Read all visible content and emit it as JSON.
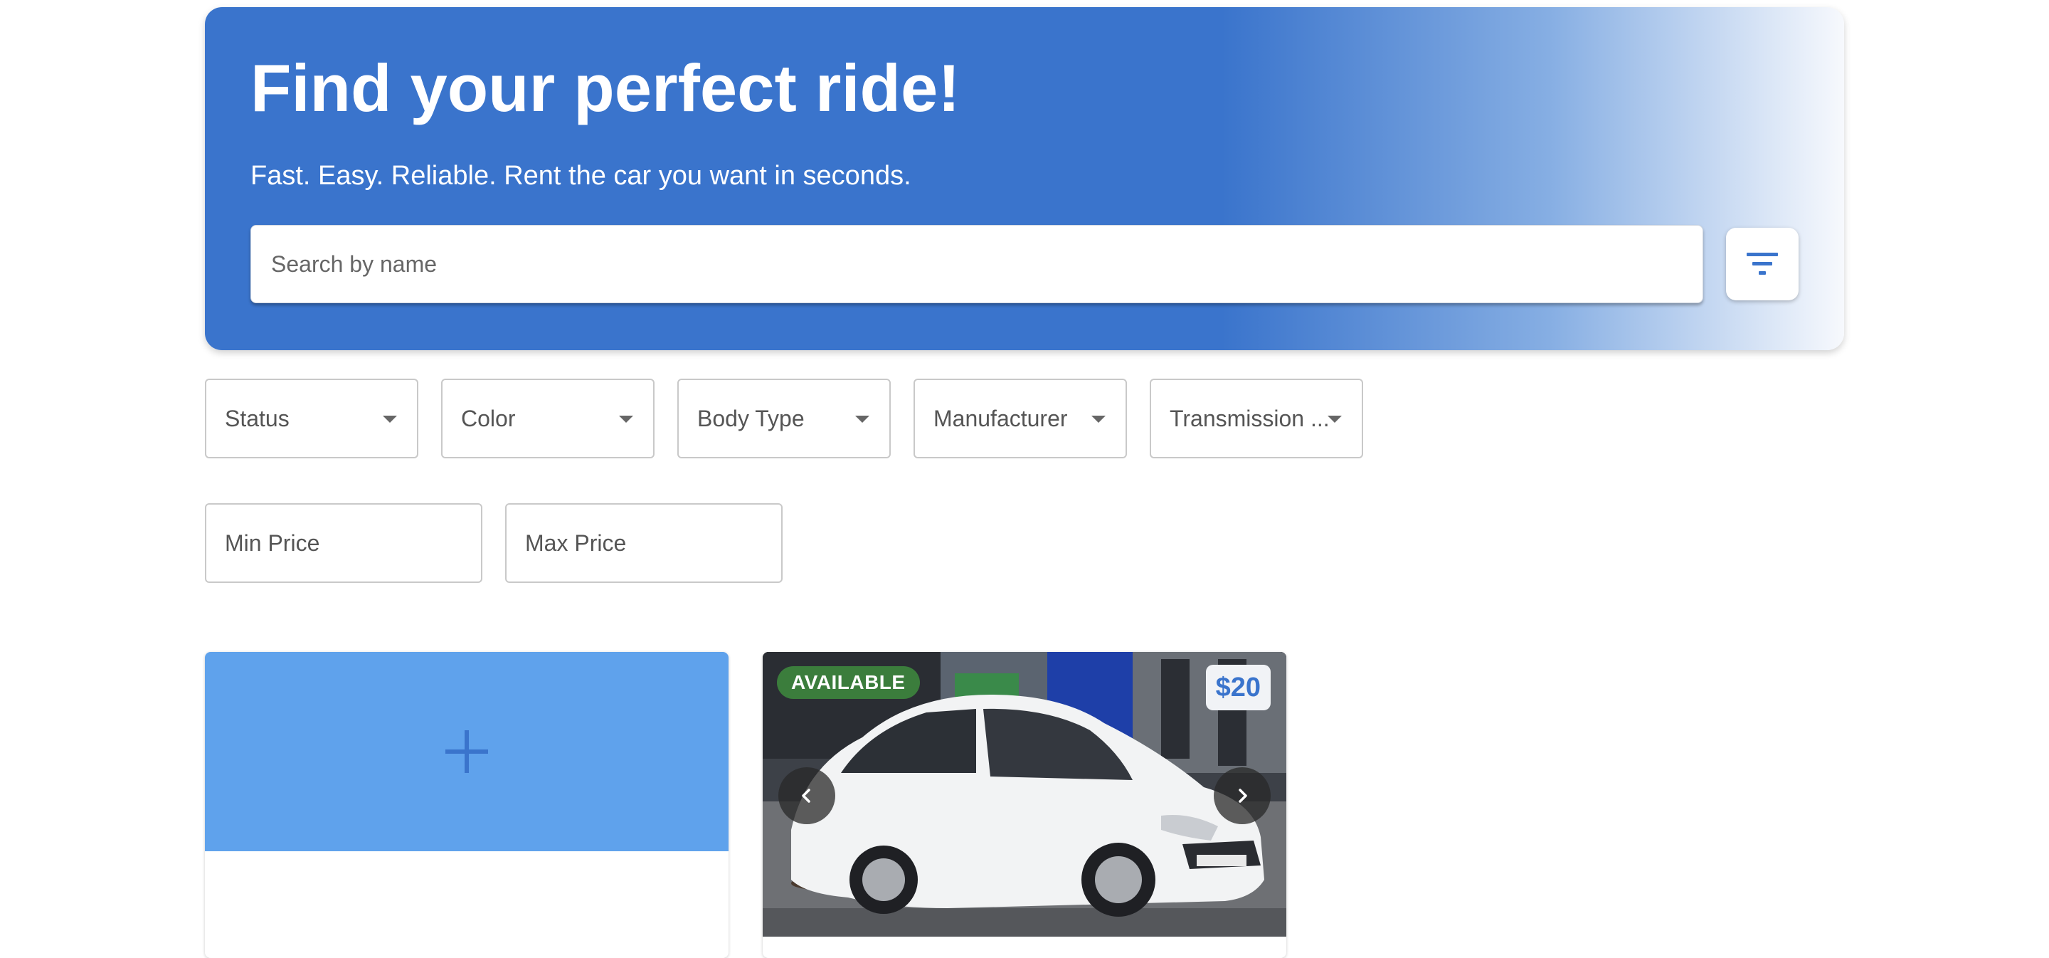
{
  "hero": {
    "title": "Find your perfect ride!",
    "subtitle": "Fast. Easy. Reliable. Rent the car you want in seconds.",
    "search_placeholder": "Search by name",
    "filter_icon": "filter-list-icon"
  },
  "filters": {
    "selects": [
      {
        "label": "Status"
      },
      {
        "label": "Color"
      },
      {
        "label": "Body Type"
      },
      {
        "label": "Manufacturer"
      },
      {
        "label": "Transmission ..."
      }
    ],
    "min_price_placeholder": "Min Price",
    "max_price_placeholder": "Max Price"
  },
  "cards": {
    "add_card": {
      "icon": "plus-icon"
    },
    "car_card": {
      "status_badge": "AVAILABLE",
      "price": "$20",
      "prev_icon": "chevron-left-icon",
      "next_icon": "chevron-right-icon",
      "photo": "white hatchback car"
    }
  },
  "colors": {
    "primary": "#3a74cc",
    "add_card_bg": "#5fa2ec",
    "available_badge": "#3b7d3c"
  }
}
